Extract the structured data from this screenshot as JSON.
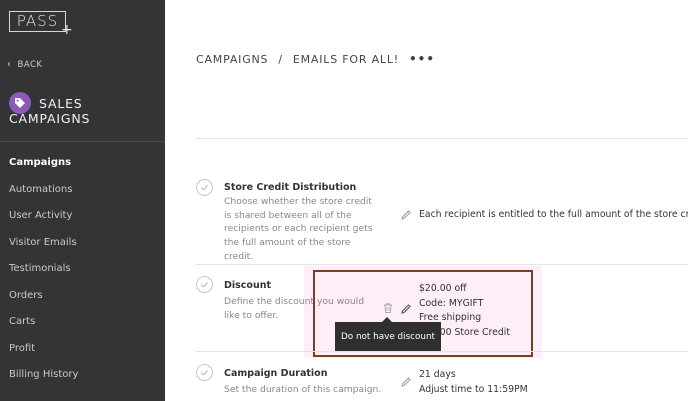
{
  "sidebar": {
    "logo": "PASS",
    "logo_plus": "+",
    "back_label": "BACK",
    "section_title_line1": "SALES",
    "section_title_line2": "CAMPAIGNS",
    "icon_color": "#8b5bb8",
    "nav_items": [
      {
        "label": "Campaigns",
        "active": true
      },
      {
        "label": "Automations"
      },
      {
        "label": "User Activity"
      },
      {
        "label": "Visitor Emails"
      },
      {
        "label": "Testimonials"
      },
      {
        "label": "Orders"
      },
      {
        "label": "Carts"
      },
      {
        "label": "Profit"
      },
      {
        "label": "Billing History"
      }
    ]
  },
  "breadcrumb": {
    "root": "CAMPAIGNS",
    "separator": "/",
    "current": "EMAILS FOR ALL!",
    "more": "•••"
  },
  "steps": [
    {
      "title": "Store Credit Distribution",
      "description": "Choose whether the store credit is shared between all of the recipients or each recipient gets the full amount of the store credit.",
      "value_lines": [
        "Each recipient is entitled to the full amount of the store credit"
      ]
    },
    {
      "title": "Discount",
      "description": "Define the discount you would like to offer.",
      "value_lines": [
        "$20.00 off",
        "Code: MYGIFT",
        "Free shipping",
        "$20.00 Store Credit"
      ],
      "tooltip": "Do not have discount"
    },
    {
      "title": "Campaign Duration",
      "description": "Set the duration of this campaign.",
      "value_lines": [
        "21 days",
        "Adjust time to 11:59PM"
      ]
    }
  ]
}
